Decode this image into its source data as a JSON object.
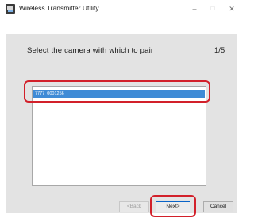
{
  "window": {
    "title": "Wireless Transmitter Utility",
    "controls": {
      "minimize": "–",
      "maximize": "□",
      "close": "✕"
    }
  },
  "page": {
    "instruction": "Select the camera with which to pair",
    "step": "1/5"
  },
  "camera_list": {
    "items": [
      {
        "label": "7777_0001256",
        "selected": true
      }
    ]
  },
  "buttons": {
    "back": "<Back",
    "next": "Next>",
    "cancel": "Cancel"
  },
  "colors": {
    "highlight": "#d2202a",
    "selection": "#3f8bd6",
    "panel": "#e3e3e3"
  }
}
